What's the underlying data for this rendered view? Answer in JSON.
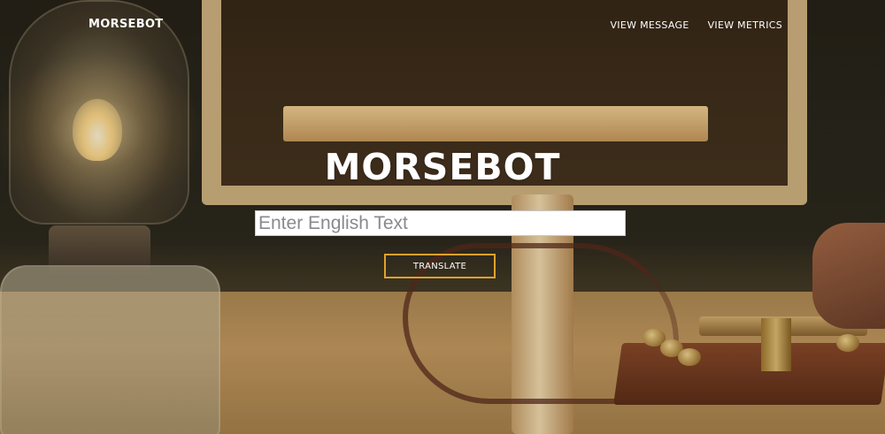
{
  "navbar": {
    "brand": "MORSEBOT",
    "links": [
      {
        "label": "VIEW MESSAGE"
      },
      {
        "label": "VIEW METRICS"
      }
    ]
  },
  "hero": {
    "title": "MORSEBOT",
    "input": {
      "placeholder": "Enter English Text",
      "value": ""
    },
    "button_label": "TRANSLATE"
  },
  "colors": {
    "accent": "#e0a22c",
    "text": "#ffffff"
  }
}
